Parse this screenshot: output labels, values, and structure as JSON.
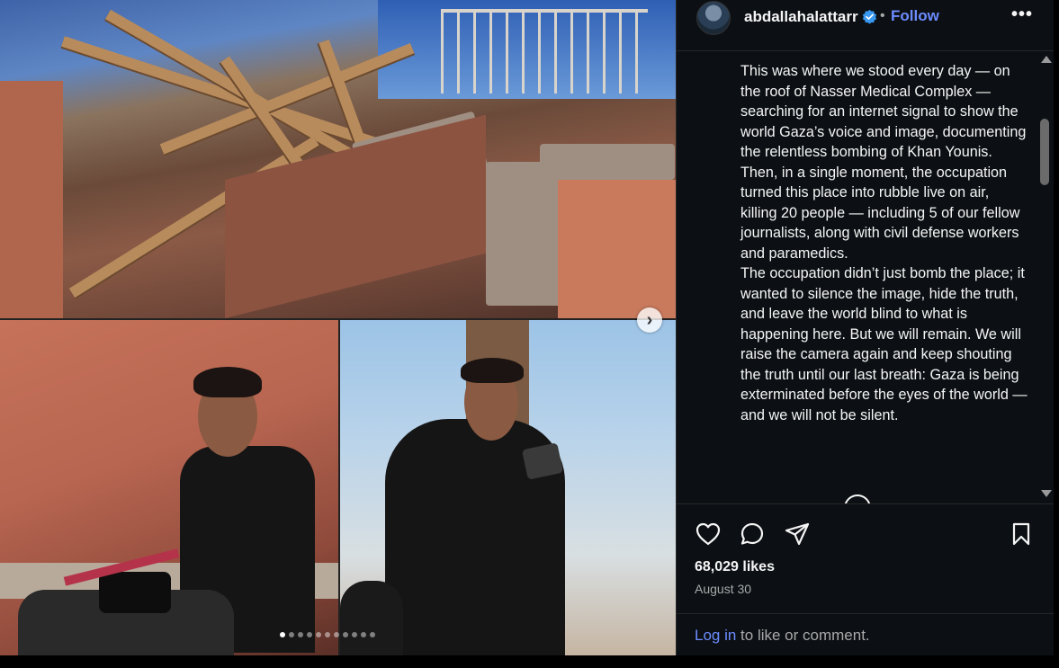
{
  "post": {
    "username": "abdallahalattarr",
    "separator": "•",
    "follow_label": "Follow",
    "more_label": "•••",
    "caption": "This was where we stood every day — on the roof of Nasser Medical Complex — searching for an internet signal to show the world Gaza’s voice and image, documenting the relentless bombing of Khan Younis. Then, in a single moment, the occupation turned this place into rubble live on air, killing 20 people — including 5 of our fellow journalists, along with civil defense workers and paramedics.\nThe occupation didn’t just bomb the place; it wanted to silence the image, hide the truth, and leave the world blind to what is happening here. But we will remain. We will raise the camera again and keep shouting the truth until our last breath: Gaza is being exterminated before the eyes of the world — and we will not be silent.",
    "likes": "68,029 likes",
    "date": "August 30",
    "login_link": "Log in",
    "login_suffix": " to like or comment."
  },
  "carousel": {
    "next_arrow": "›",
    "total_slides": 11,
    "active_slide": 1
  },
  "colors": {
    "link": "#6c8cff",
    "panel_bg": "#0c1014",
    "verified": "#3897f0"
  }
}
